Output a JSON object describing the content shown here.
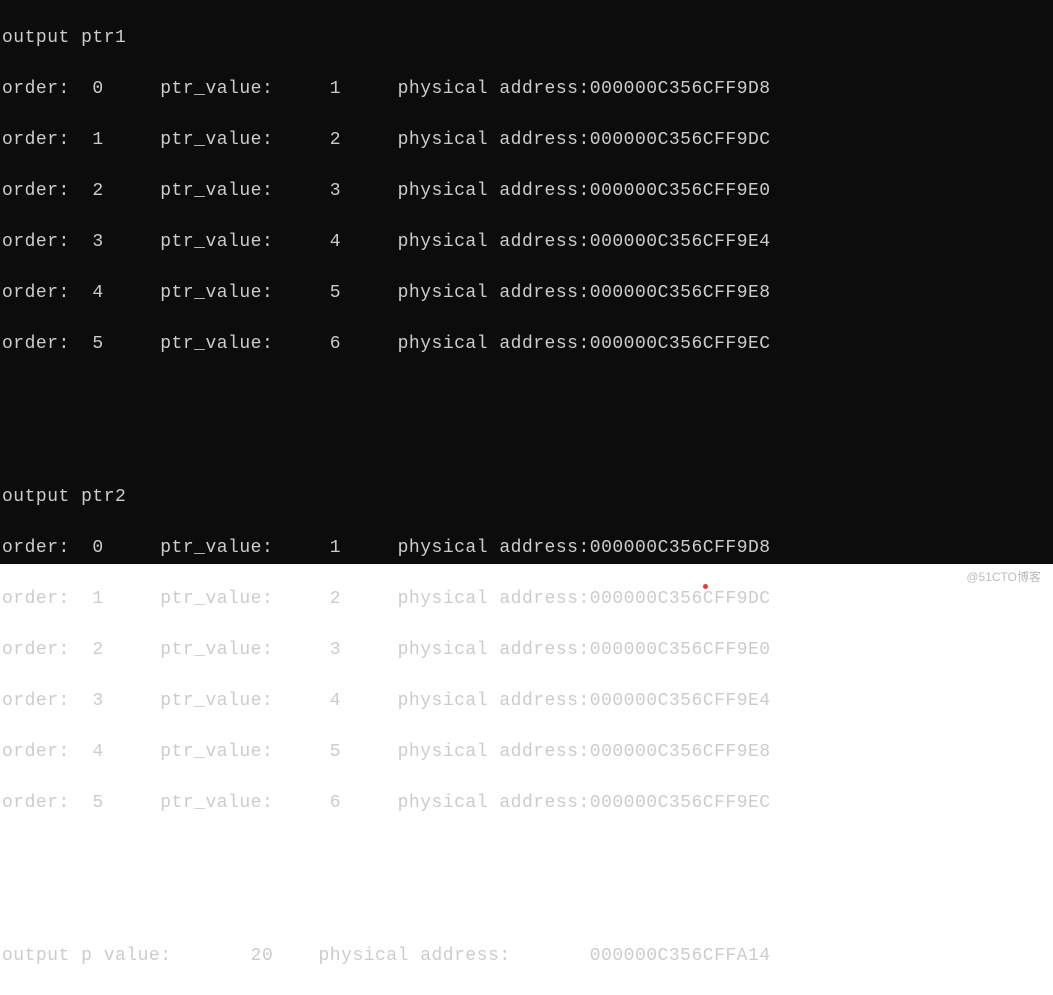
{
  "sections": {
    "ptr1": {
      "header": "output ptr1",
      "rows": [
        {
          "order": "0",
          "ptr_value": "1",
          "address": "000000C356CFF9D8"
        },
        {
          "order": "1",
          "ptr_value": "2",
          "address": "000000C356CFF9DC"
        },
        {
          "order": "2",
          "ptr_value": "3",
          "address": "000000C356CFF9E0"
        },
        {
          "order": "3",
          "ptr_value": "4",
          "address": "000000C356CFF9E4"
        },
        {
          "order": "4",
          "ptr_value": "5",
          "address": "000000C356CFF9E8"
        },
        {
          "order": "5",
          "ptr_value": "6",
          "address": "000000C356CFF9EC"
        }
      ]
    },
    "ptr2": {
      "header": "output ptr2",
      "rows": [
        {
          "order": "0",
          "ptr_value": "1",
          "address": "000000C356CFF9D8"
        },
        {
          "order": "1",
          "ptr_value": "2",
          "address": "000000C356CFF9DC"
        },
        {
          "order": "2",
          "ptr_value": "3",
          "address": "000000C356CFF9E0"
        },
        {
          "order": "3",
          "ptr_value": "4",
          "address": "000000C356CFF9E4"
        },
        {
          "order": "4",
          "ptr_value": "5",
          "address": "000000C356CFF9E8"
        },
        {
          "order": "5",
          "ptr_value": "6",
          "address": "000000C356CFF9EC"
        }
      ]
    }
  },
  "labels": {
    "order": "order:",
    "ptr_value": "ptr_value:",
    "physical_address": "physical address:"
  },
  "pvalue": {
    "label": "output p value:",
    "value": "20",
    "addr_label": "physical address:",
    "address": "000000C356CFFA14"
  },
  "watermark": "@51CTO博客"
}
